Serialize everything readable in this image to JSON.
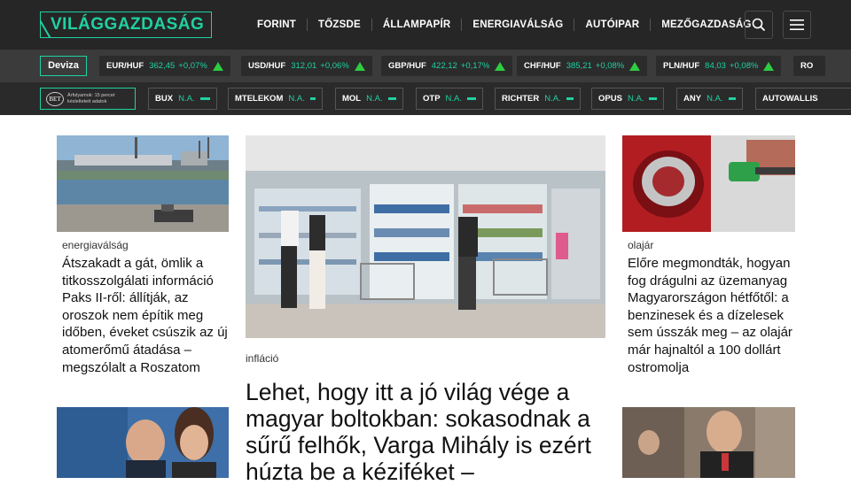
{
  "header": {
    "logo": "VILÁGGAZDASÁG",
    "nav": [
      "FORINT",
      "TŐZSDE",
      "ÁLLAMPAPÍR",
      "ENERGIAVÁLSÁG",
      "AUTÓIPAR",
      "MEZŐGAZDASÁG"
    ],
    "search_icon": "search-icon",
    "menu_icon": "hamburger-menu-icon"
  },
  "fx": {
    "label": "Deviza",
    "items": [
      {
        "pair": "EUR/HUF",
        "value": "362,45",
        "change": "+0,07%"
      },
      {
        "pair": "USD/HUF",
        "value": "312,01",
        "change": "+0,06%"
      },
      {
        "pair": "GBP/HUF",
        "value": "422,12",
        "change": "+0,17%"
      },
      {
        "pair": "CHF/HUF",
        "value": "385,21",
        "change": "+0,08%"
      },
      {
        "pair": "PLN/HUF",
        "value": "84,03",
        "change": "+0,08%"
      },
      {
        "pair": "RO",
        "value": "",
        "change": ""
      }
    ]
  },
  "stocks": {
    "bet_logo": "BET",
    "bet_note": "Árfolyamok: 15 percet késleltetett adatok",
    "items": [
      {
        "name": "BUX",
        "value": "N.A."
      },
      {
        "name": "MTELEKOM",
        "value": "N.A."
      },
      {
        "name": "MOL",
        "value": "N.A."
      },
      {
        "name": "OTP",
        "value": "N.A."
      },
      {
        "name": "RICHTER",
        "value": "N.A."
      },
      {
        "name": "OPUS",
        "value": "N.A."
      },
      {
        "name": "ANY",
        "value": "N.A."
      },
      {
        "name": "AUTOWALLIS",
        "value": ""
      }
    ]
  },
  "articles": {
    "left": {
      "category": "energiaválság",
      "title": "Átszakadt a gát, ömlik a titkosszolgálati információ Paks II-ről: állítják, az oroszok nem építik meg időben, éveket csúszik az új atomerőmű átadása – megszólalt a Roszatom"
    },
    "lead": {
      "category": "infláció",
      "title": "Lehet, hogy itt a jó világ vége a magyar boltokban: sokasodnak a sűrű felhők, Varga Mihály is ezért húzta be a kéziféket –"
    },
    "right": {
      "category": "olajár",
      "title": "Előre megmondták, hogyan fog drágulni az üzemanyag Magyarországon hétfőtől: a benzinesek és a dízelesek sem ússzák meg – az olajár már hajnaltól a 100 dollárt ostromolja"
    }
  },
  "colors": {
    "accent": "#1fd1a2",
    "header_bg": "#262626",
    "fx_bg": "#3b3b3b",
    "stock_bg": "#2a2a2a",
    "up": "#2ecc40"
  }
}
